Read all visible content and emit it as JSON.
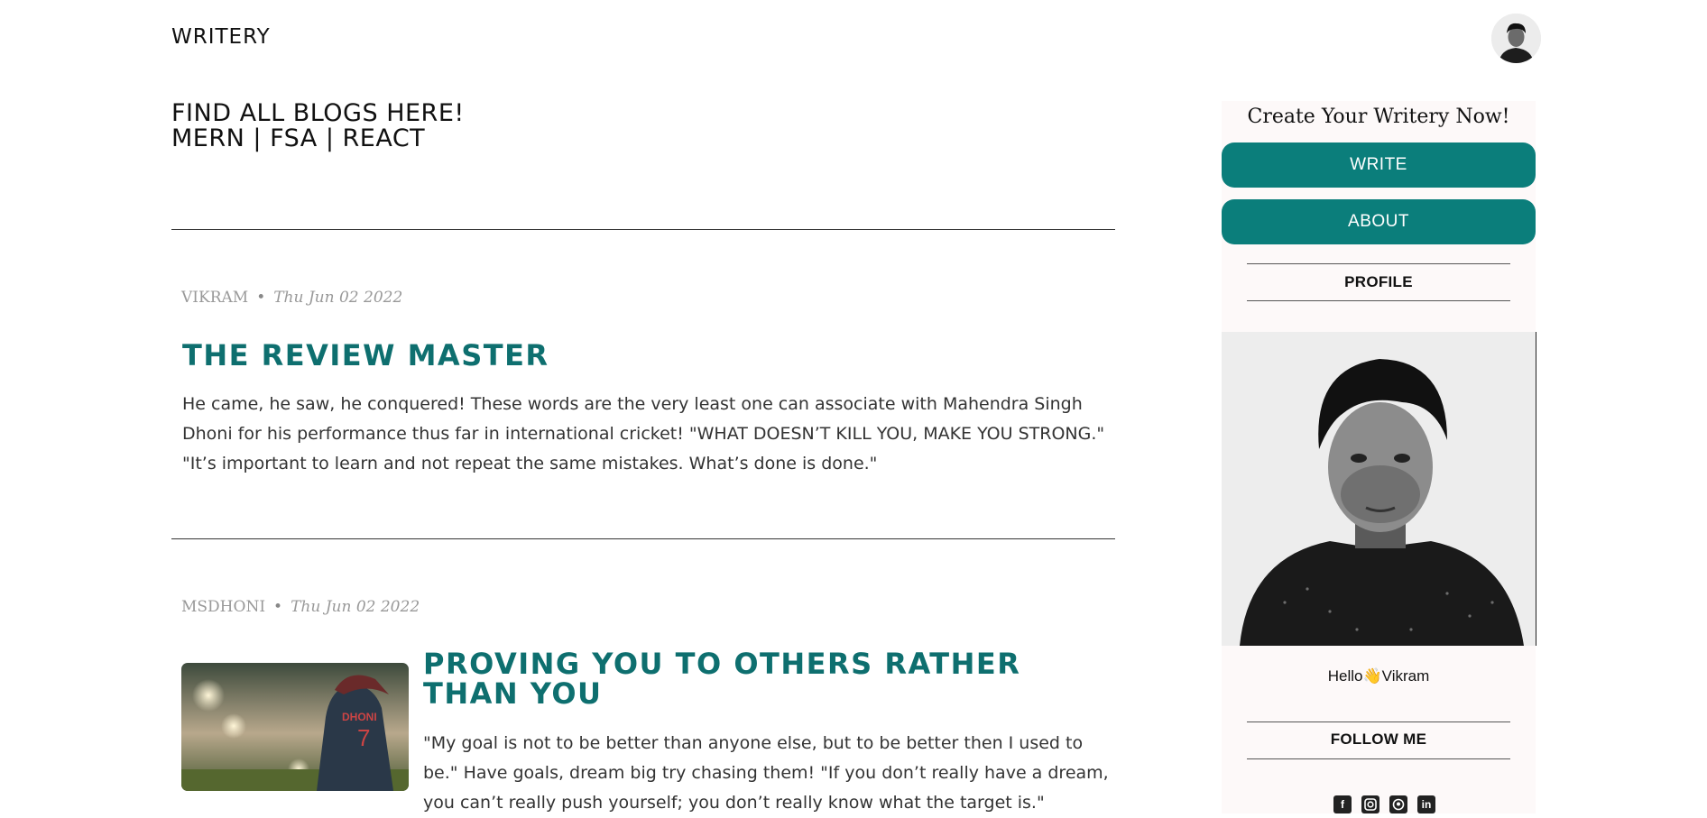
{
  "header": {
    "brand": "WRITERY"
  },
  "hero": {
    "line1": "FIND ALL BLOGS HERE!",
    "line2": "MERN | FSA | REACT"
  },
  "posts": [
    {
      "author": "VIKRAM",
      "date": "Thu Jun 02 2022",
      "title": "THE REVIEW MASTER",
      "body": "He came, he saw, he conquered! These words are the very least one can associate with Mahendra Singh Dhoni for his performance thus far in international cricket! \"WHAT DOESN’T KILL YOU, MAKE YOU STRONG.\" \"It’s important to learn and not repeat the same mistakes. What’s done is done.\""
    },
    {
      "author": "MSDHONI",
      "date": "Thu Jun 02 2022",
      "title": "PROVING YOU TO OTHERS RATHER THAN YOU",
      "body": "\"My goal is not to be better than anyone else, but to be better then I used to be.\" Have goals, dream big try chasing them! \"If you don’t really have a dream, you can’t really push yourself; you don’t really know what the target is.\""
    }
  ],
  "sidebar": {
    "title": "Create Your Writery Now!",
    "write_label": "WRITE",
    "about_label": "ABOUT",
    "profile_label": "PROFILE",
    "hello_text": "Hello👋Vikram",
    "follow_label": "FOLLOW ME",
    "social_icons": [
      "facebook-icon",
      "instagram-icon",
      "github-icon",
      "linkedin-icon"
    ]
  },
  "colors": {
    "accent": "#0b7e7b",
    "title": "#0e6f6f",
    "meta": "#999999",
    "sidebar_bg": "#fdf9f9"
  }
}
